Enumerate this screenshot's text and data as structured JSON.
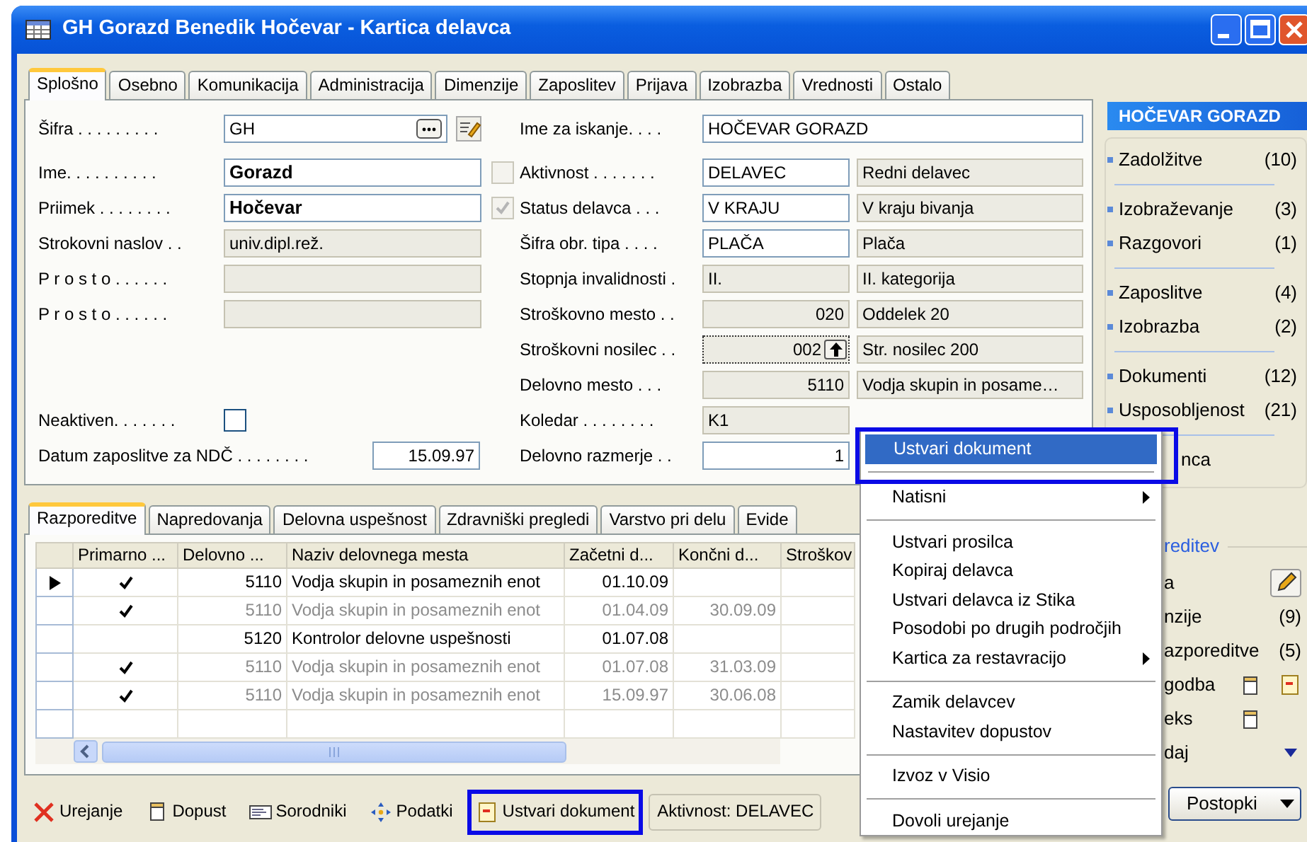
{
  "window": {
    "title": "GH Gorazd Benedik Hočevar - Kartica delavca"
  },
  "tabs": [
    {
      "label": "Splošno",
      "selected": true
    },
    {
      "label": "Osebno",
      "selected": false
    },
    {
      "label": "Komunikacija",
      "selected": false
    },
    {
      "label": "Administracija",
      "selected": false
    },
    {
      "label": "Dimenzije",
      "selected": false
    },
    {
      "label": "Zaposlitev",
      "selected": false
    },
    {
      "label": "Prijava",
      "selected": false
    },
    {
      "label": "Izobrazba",
      "selected": false
    },
    {
      "label": "Vrednosti",
      "selected": false
    },
    {
      "label": "Ostalo",
      "selected": false
    }
  ],
  "form_rows": [
    {
      "left": {
        "kind": "lookup",
        "label": "Šifra . . . . . . . . .",
        "value": "GH",
        "editable": true
      },
      "right": {
        "label": "Ime za iskanje. . . .",
        "value": "HOČEVAR GORAZD",
        "editable": true,
        "wide": true
      }
    },
    {
      "left": {
        "kind": "text",
        "label": "Ime. . . . . . . . . .",
        "value": "Gorazd",
        "editable": true,
        "bold": true
      },
      "right": {
        "label": "Aktivnost . . . . . . .",
        "value": "DELAVEC",
        "editable": true,
        "description": "Redni delavec",
        "checkbox": {
          "checked": false,
          "disabled": true
        }
      }
    },
    {
      "left": {
        "kind": "text",
        "label": "Priimek . . . . . . . .",
        "value": "Hočevar",
        "editable": true,
        "bold": true
      },
      "right": {
        "label": "Status delavca . . .",
        "value": "V KRAJU",
        "editable": true,
        "description": "V kraju bivanja",
        "checkbox": {
          "checked": true,
          "disabled": true
        }
      }
    },
    {
      "left": {
        "kind": "text",
        "label": "Strokovni naslov . .",
        "value": "univ.dipl.rež.",
        "editable": false
      },
      "right": {
        "label": "Šifra obr. tipa . . . .",
        "value": "PLAČA",
        "editable": true,
        "description": "Plača"
      }
    },
    {
      "left": {
        "kind": "text",
        "label": "P r o s t o . . . . . .",
        "editable": false
      },
      "right": {
        "label": "Stopnja invalidnosti .",
        "value": "II.",
        "editable": false,
        "description": "II. kategorija"
      }
    },
    {
      "left": {
        "kind": "text",
        "label": "P r o s t o . . . . . .",
        "editable": false
      },
      "right": {
        "label": "Stroškovno mesto . .",
        "value": "020",
        "editable": false,
        "numeric": true,
        "description": "Oddelek 20"
      }
    },
    {
      "right": {
        "label": "Stroškovni nosilec . .",
        "value": "002",
        "editable": false,
        "numeric": true,
        "focused": true,
        "assist": true,
        "description": "Str. nosilec 200"
      }
    },
    {
      "right": {
        "label": "Delovno mesto . . .",
        "value": "5110",
        "editable": false,
        "numeric": true,
        "description": "Vodja skupin in posame…"
      }
    },
    {
      "left": {
        "kind": "check",
        "label": "Neaktiven. . . . . . .",
        "checked": false
      },
      "right": {
        "label": "Koledar . . . . . . . .",
        "value": "K1",
        "editable": false
      }
    },
    {
      "left": {
        "kind": "date",
        "label": "Datum zaposlitve za NDČ . . . . . . . .",
        "value": "15.09.97",
        "editable": true
      },
      "right": {
        "label": "Delovno razmerje . .",
        "value": "1",
        "editable": true,
        "numeric": true
      }
    }
  ],
  "lower_tabs": [
    {
      "label": "Razporeditve",
      "selected": true
    },
    {
      "label": "Napredovanja",
      "selected": false
    },
    {
      "label": "Delovna uspešnost",
      "selected": false
    },
    {
      "label": "Zdravniški pregledi",
      "selected": false
    },
    {
      "label": "Varstvo pri delu",
      "selected": false
    },
    {
      "label": "Evide",
      "selected": false
    }
  ],
  "table": {
    "columns": [
      "Primarno ...",
      "Delovno ...",
      "Naziv delovnega mesta",
      "Začetni d...",
      "Končni d...",
      "Stroškov"
    ],
    "rows": [
      {
        "current": true,
        "primary": true,
        "active": true,
        "code": "5110",
        "name": "Vodja skupin in posameznih enot",
        "start": "01.10.09"
      },
      {
        "current": false,
        "primary": true,
        "active": false,
        "code": "5110",
        "name": "Vodja skupin in posameznih enot",
        "start": "01.04.09",
        "end": "30.09.09"
      },
      {
        "current": false,
        "primary": false,
        "active": true,
        "code": "5120",
        "name": "Kontrolor delovne uspešnosti",
        "start": "01.07.08"
      },
      {
        "current": false,
        "primary": true,
        "active": false,
        "code": "5110",
        "name": "Vodja skupin in posameznih enot",
        "start": "01.07.08",
        "end": "31.03.09"
      },
      {
        "current": false,
        "primary": true,
        "active": false,
        "code": "5110",
        "name": "Vodja skupin in posameznih enot",
        "start": "15.09.97",
        "end": "30.06.08"
      }
    ]
  },
  "bottom_bar": {
    "buttons": [
      {
        "kind": "cross",
        "label": "Urejanje",
        "highlighted": false
      },
      {
        "kind": "page",
        "label": "Dopust",
        "highlighted": false
      },
      {
        "kind": "card",
        "label": "Sorodniki",
        "highlighted": false
      },
      {
        "kind": "arrows",
        "label": "Podatki",
        "highlighted": false
      },
      {
        "kind": "document",
        "label": "Ustvari dokument",
        "highlighted": true
      }
    ],
    "status": "Aktivnost: DELAVEC",
    "menu_button": "Postopki"
  },
  "side_panel": {
    "title": "HOČEVAR GORAZD",
    "groups": [
      {
        "items": [
          {
            "label": "Zadolžitve",
            "count": "(10)"
          }
        ]
      },
      {
        "items": [
          {
            "label": "Izobraževanje",
            "count": "(3)"
          },
          {
            "label": "Razgovori",
            "count": "(1)"
          }
        ]
      },
      {
        "items": [
          {
            "label": "Zaposlitve",
            "count": "(4)"
          },
          {
            "label": "Izobrazba",
            "count": "(2)"
          }
        ]
      },
      {
        "items": [
          {
            "label": "Dokumenti",
            "count": "(12)"
          },
          {
            "label": "Usposobljenost",
            "count": "(21)"
          }
        ]
      }
    ],
    "covered_item": "nca",
    "section": {
      "title": "reditev",
      "items": [
        {
          "kind": "edit",
          "label": "a"
        },
        {
          "kind": "count",
          "label": "nzije",
          "count": "(9)"
        },
        {
          "kind": "count",
          "label": "azporeditve",
          "count": "(5)"
        },
        {
          "kind": "docs",
          "label": "godba"
        },
        {
          "kind": "doc",
          "label": "eks"
        },
        {
          "kind": "expand",
          "label": "daj"
        }
      ]
    }
  },
  "context_menu": {
    "items": [
      {
        "kind": "item",
        "label": "Ustvari dokument",
        "selected": true,
        "highlighted": true,
        "submenu": false
      },
      {
        "kind": "separator"
      },
      {
        "kind": "item",
        "label": "Natisni",
        "selected": false,
        "submenu": true
      },
      {
        "kind": "separator"
      },
      {
        "kind": "item",
        "label": "Ustvari prosilca",
        "selected": false,
        "submenu": false
      },
      {
        "kind": "item",
        "label": "Kopiraj delavca",
        "selected": false,
        "submenu": false
      },
      {
        "kind": "item",
        "label": "Ustvari delavca iz Stika",
        "selected": false,
        "submenu": false
      },
      {
        "kind": "item",
        "label": "Posodobi po drugih področjih",
        "selected": false,
        "submenu": false
      },
      {
        "kind": "item",
        "label": "Kartica za restavracijo",
        "selected": false,
        "submenu": true
      },
      {
        "kind": "separator"
      },
      {
        "kind": "item",
        "label": "Zamik delavcev",
        "selected": false,
        "submenu": false
      },
      {
        "kind": "item",
        "label": "Nastavitev dopustov",
        "selected": false,
        "submenu": false
      },
      {
        "kind": "separator"
      },
      {
        "kind": "item",
        "label": "Izvoz v Visio",
        "selected": false,
        "submenu": false
      },
      {
        "kind": "separator"
      },
      {
        "kind": "item",
        "label": "Dovoli urejanje",
        "selected": false,
        "submenu": false
      }
    ]
  }
}
